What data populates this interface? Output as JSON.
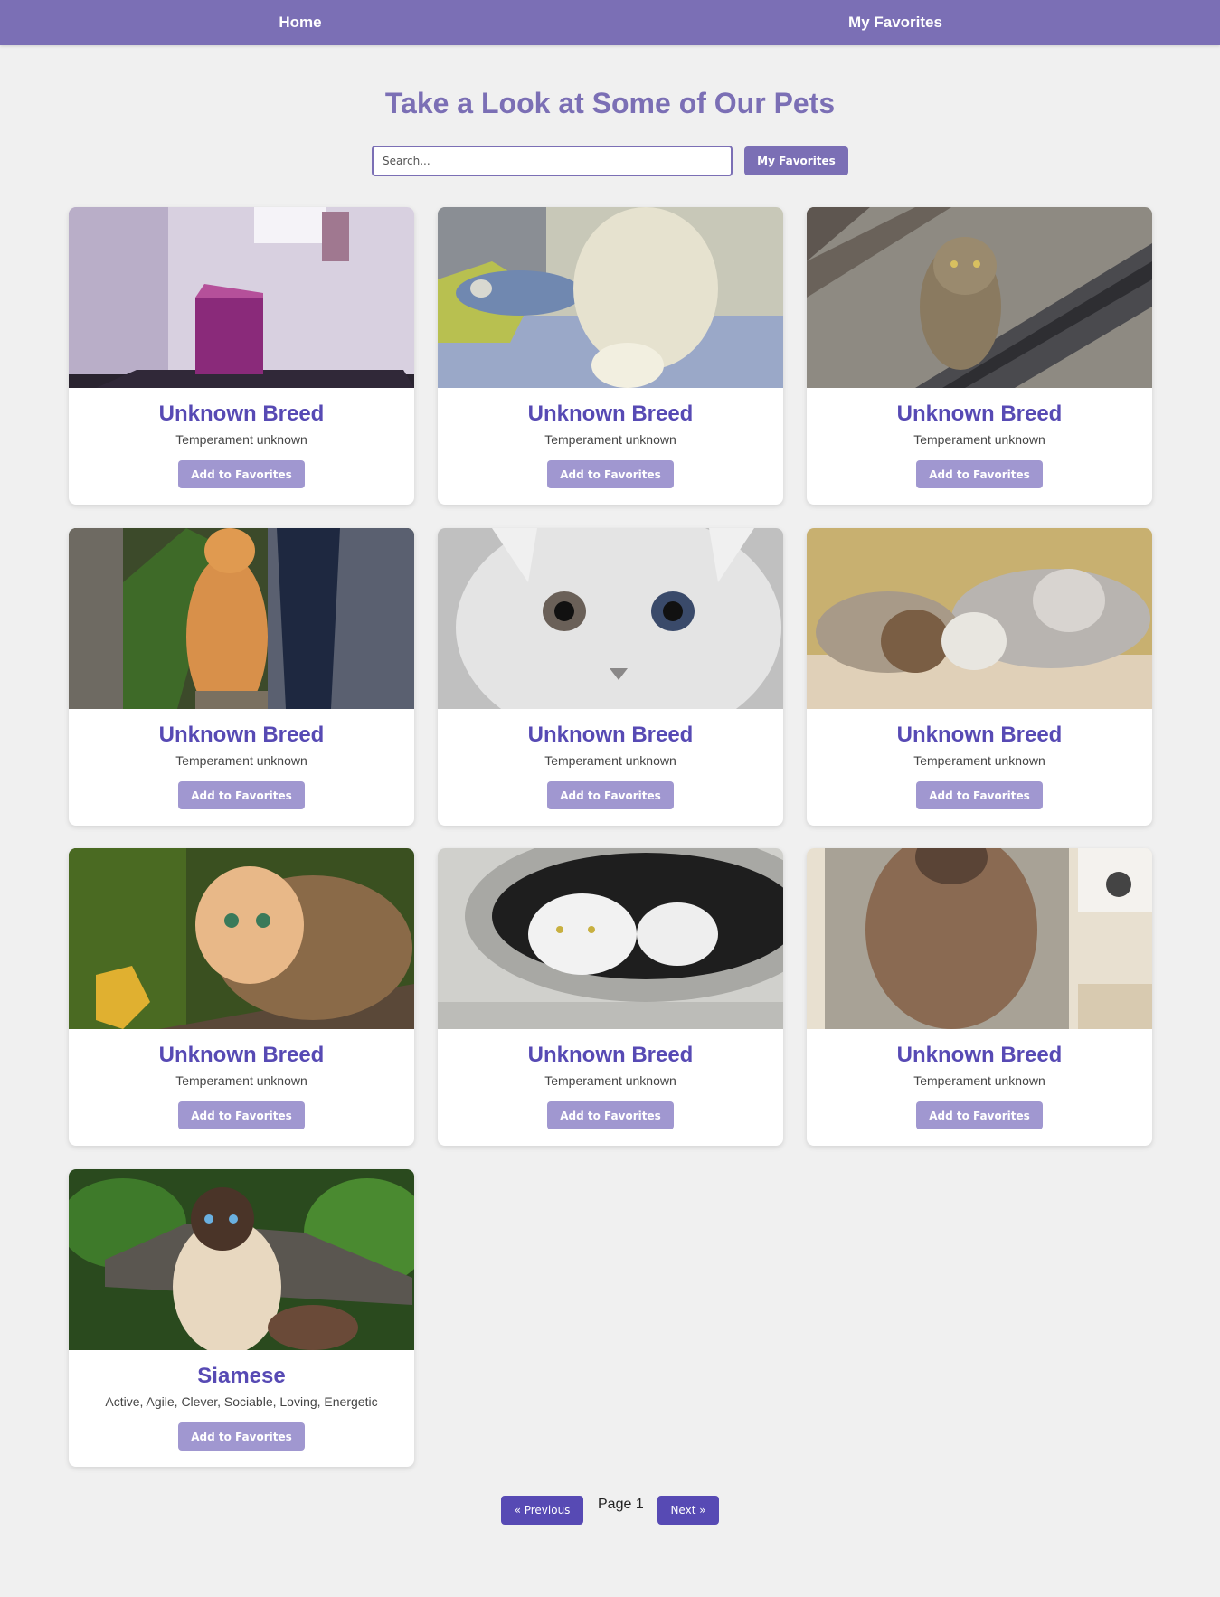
{
  "nav": {
    "home": "Home",
    "favorites": "My Favorites"
  },
  "header": {
    "title": "Take a Look at Some of Our Pets",
    "search_placeholder": "Search...",
    "favorites_button": "My Favorites"
  },
  "cards": [
    {
      "title": "Unknown Breed",
      "temperament": "Temperament unknown",
      "button": "Add to Favorites"
    },
    {
      "title": "Unknown Breed",
      "temperament": "Temperament unknown",
      "button": "Add to Favorites"
    },
    {
      "title": "Unknown Breed",
      "temperament": "Temperament unknown",
      "button": "Add to Favorites"
    },
    {
      "title": "Unknown Breed",
      "temperament": "Temperament unknown",
      "button": "Add to Favorites"
    },
    {
      "title": "Unknown Breed",
      "temperament": "Temperament unknown",
      "button": "Add to Favorites"
    },
    {
      "title": "Unknown Breed",
      "temperament": "Temperament unknown",
      "button": "Add to Favorites"
    },
    {
      "title": "Unknown Breed",
      "temperament": "Temperament unknown",
      "button": "Add to Favorites"
    },
    {
      "title": "Unknown Breed",
      "temperament": "Temperament unknown",
      "button": "Add to Favorites"
    },
    {
      "title": "Unknown Breed",
      "temperament": "Temperament unknown",
      "button": "Add to Favorites"
    },
    {
      "title": "Siamese",
      "temperament": "Active, Agile, Clever, Sociable, Loving, Energetic",
      "button": "Add to Favorites"
    }
  ],
  "pagination": {
    "previous": "« Previous",
    "page": "Page 1",
    "next": "Next »"
  },
  "colors": {
    "navbar": "#7b6fb5",
    "title": "#7b6fb5",
    "card_title": "#574ab4",
    "card_button": "#a097d0",
    "pagination_button": "#574ab4",
    "background": "#f0f0f0"
  }
}
